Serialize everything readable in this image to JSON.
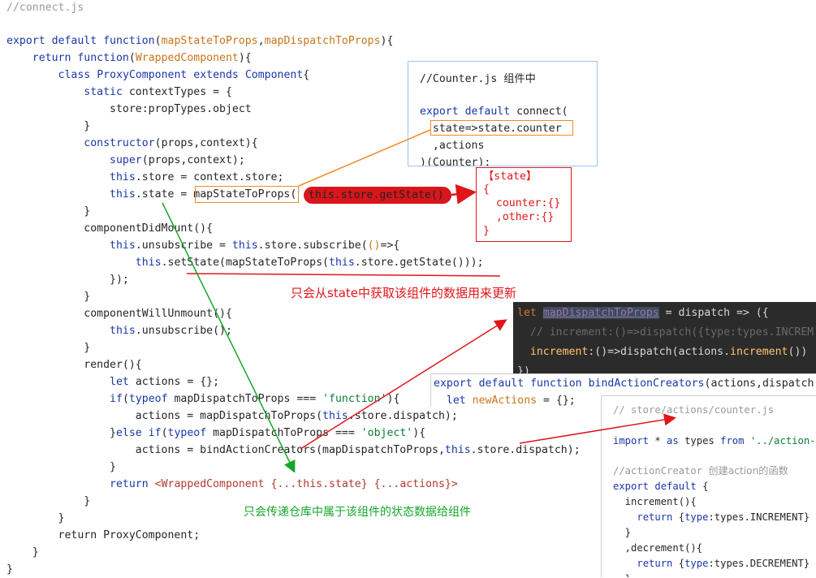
{
  "main_code": {
    "lines": [
      "//connect.js",
      "",
      "export default function(mapStateToProps,mapDispatchToProps){",
      "    return function(WrappedComponent){",
      "        class ProxyComponent extends Component{",
      "            static contextTypes = {",
      "                store:propTypes.object",
      "            }",
      "            constructor(props,context){",
      "                super(props,context);",
      "                this.store = context.store;",
      "                this.state = mapStateToProps(this.store.getState());",
      "            }",
      "            componentDidMount(){",
      "                this.unsubscribe = this.store.subscribe(()=>{",
      "                    this.setState(mapStateToProps(this.store.getState()));",
      "                });",
      "            }",
      "            componentWillUnmount(){",
      "                this.unsubscribe();",
      "            }",
      "            render(){",
      "                let actions = {};",
      "                if(typeof mapDispatchToProps === 'function'){",
      "                    actions = mapDispatchToProps(this.store.dispatch);",
      "                }else if(typeof mapDispatchToProps === 'object'){",
      "                    actions = bindActionCreators(mapDispatchToProps,this.store.dispatch);",
      "                }",
      "                return <WrappedComponent {...this.state} {...actions}>",
      "            }",
      "        }",
      "        return ProxyComponent;",
      "    }",
      "}"
    ]
  },
  "counter_box": {
    "comment": "//Counter.js",
    "comment_zh": "组件中",
    "lines": [
      "export default connect(",
      "  state=>state.counter",
      "  ,actions",
      ")(Counter);"
    ]
  },
  "state_box": {
    "title": "【state】",
    "lines": [
      "{",
      "  counter:{}",
      "  ,other:{}",
      "}"
    ]
  },
  "dispatch_box": {
    "lines": [
      "let mapDispatchToProps = dispatch => ({",
      "  // increment:()=>dispatch({type:types.INCREM",
      "  increment:()=>dispatch(actions.increment())",
      "})"
    ]
  },
  "bind_box": {
    "lines": [
      "export default function bindActionCreators(actions,dispatch",
      "  let newActions = {};"
    ]
  },
  "actions_box": {
    "lines": [
      "// store/actions/counter.js",
      "",
      "import * as types from '../action-",
      "",
      "//actionCreator 创建action的函数",
      "export default {",
      "  increment(){",
      "    return {type:types.INCREMENT}",
      "  }",
      "  ,decrement(){",
      "    return {type:types.DECREMENT}",
      "  }"
    ]
  },
  "annotations": {
    "red_note": "只会从state中获取该组件的数据用来更新",
    "green_note": "只会传递仓库中属于该组件的状态数据给组件"
  },
  "colors": {
    "keyword": "#1a37a8",
    "param": "#c8741a",
    "string": "#0b7d3a",
    "comment": "#9a9a9a",
    "annotation_red": "#e0161b",
    "annotation_green": "#15a62a",
    "annotation_orange": "#f08a24",
    "dark_panel": "#2b2b2b"
  }
}
